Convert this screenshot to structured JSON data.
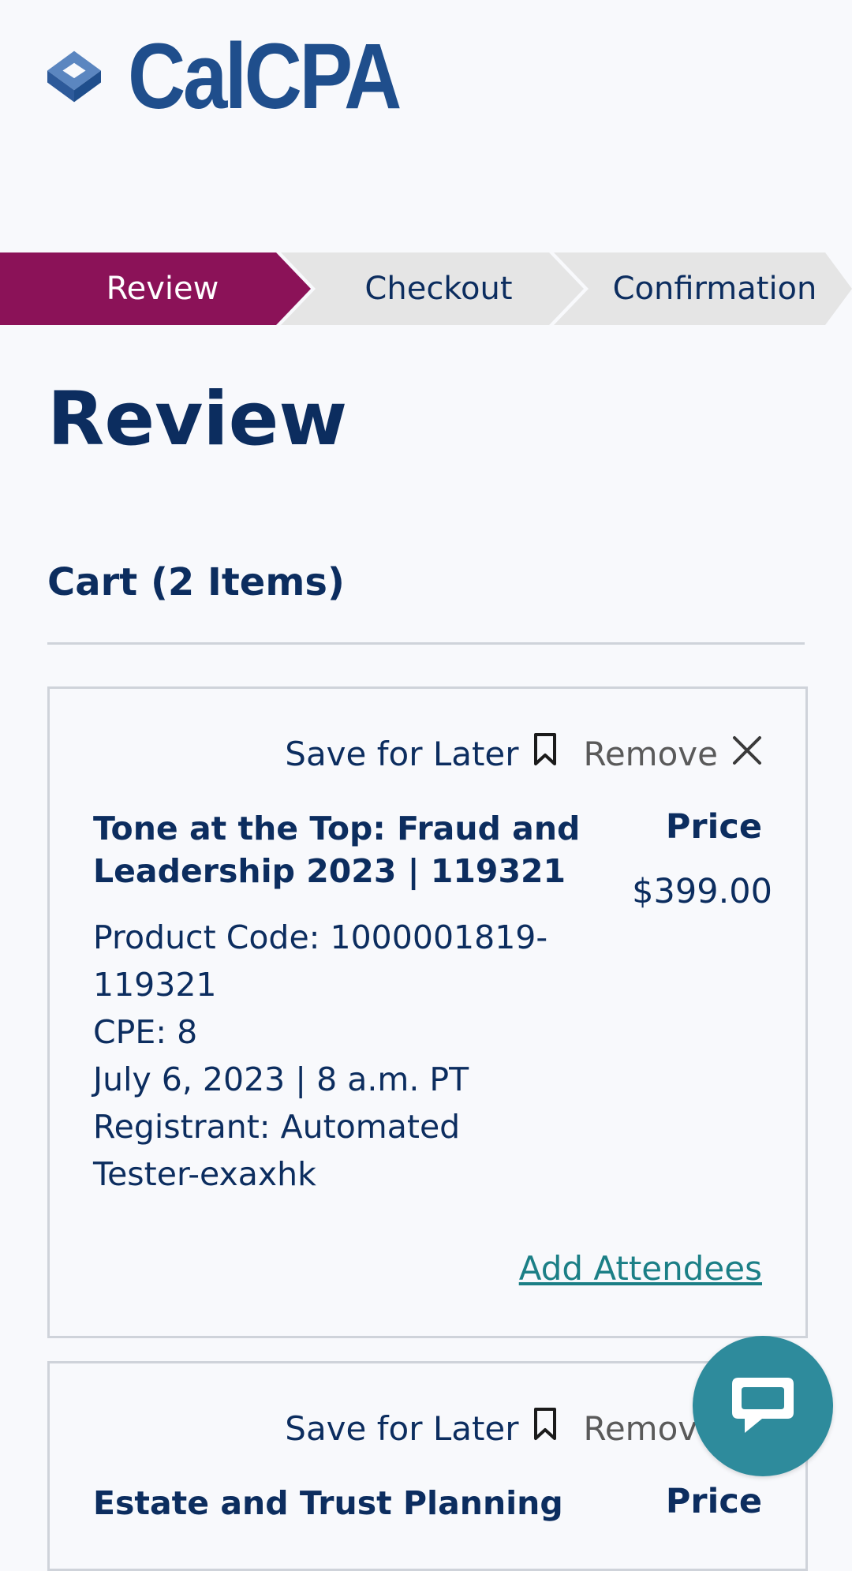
{
  "brand": {
    "name": "CalCPA"
  },
  "steps": [
    {
      "label": "Review",
      "active": true
    },
    {
      "label": "Checkout",
      "active": false
    },
    {
      "label": "Confirmation",
      "active": false
    }
  ],
  "page": {
    "title": "Review"
  },
  "cart": {
    "title": "Cart (2 Items)",
    "items": [
      {
        "save_label": "Save for Later",
        "remove_label": "Remove",
        "title": "Tone at the Top: Fraud and Leadership 2023 | 119321",
        "price_label": "Price",
        "price": "$399.00",
        "details": [
          "Product Code: 1000001819-119321",
          "CPE: 8",
          "July 6, 2023 | 8 a.m. PT",
          "Registrant: Automated Tester-exaxhk"
        ],
        "add_attendees": "Add Attendees"
      },
      {
        "save_label": "Save for Later",
        "remove_label": "Remove",
        "title": "Estate and Trust Planning",
        "price_label": "Price"
      }
    ]
  },
  "colors": {
    "active_step": "#8b1258",
    "inactive_step": "#e5e5e5",
    "navy": "#0c2d5f",
    "link": "#1b7f86",
    "chat": "#2e8b9c"
  },
  "icons": {
    "logo": "calcpa-diamond-logo-icon",
    "save": "bookmark-icon",
    "remove": "close-icon",
    "chat": "chat-bubble-icon"
  }
}
